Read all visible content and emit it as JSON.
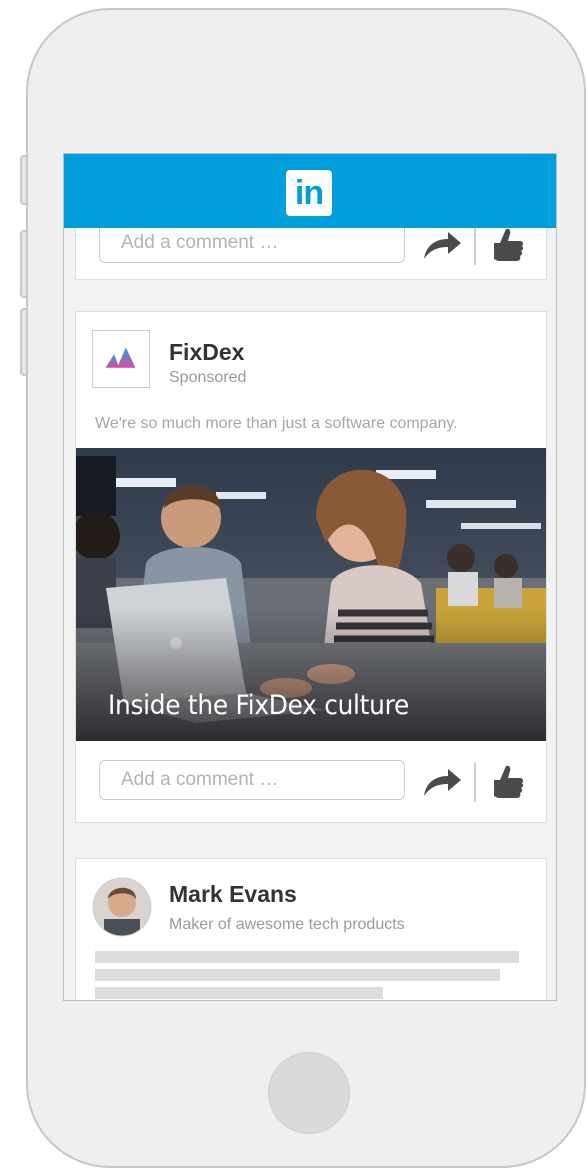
{
  "app": {
    "logo_text": "in",
    "brand_color": "#009fdb"
  },
  "comment_placeholder": "Add a comment …",
  "posts": [
    {
      "author": "FixDex",
      "subtitle": "Sponsored",
      "text": "We're so much more than just a software company.",
      "image_caption": "Inside the FixDex culture"
    },
    {
      "author": "Mark Evans",
      "subtitle": "Maker of awesome tech products"
    }
  ],
  "icons": [
    "share-icon",
    "like-icon",
    "fixdex-logo-icon",
    "linkedin-logo-icon"
  ]
}
